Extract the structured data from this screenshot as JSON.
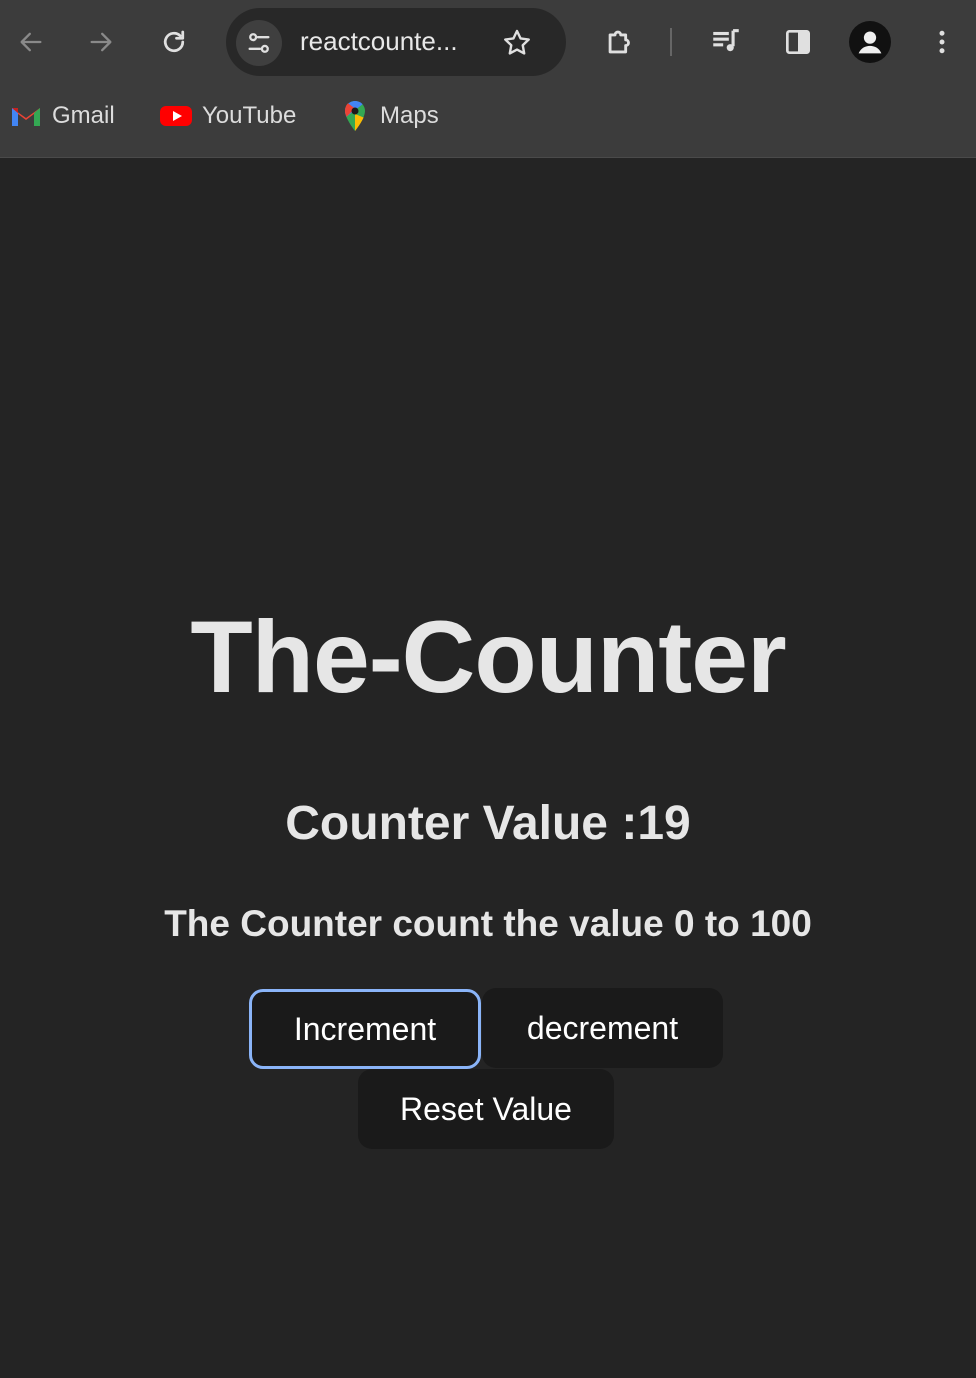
{
  "browser": {
    "url": "reactcounte...",
    "bookmarks": [
      {
        "label": "Gmail",
        "icon": "gmail-icon"
      },
      {
        "label": "YouTube",
        "icon": "youtube-icon"
      },
      {
        "label": "Maps",
        "icon": "maps-icon"
      }
    ]
  },
  "page": {
    "title": "The-Counter",
    "counter_value_text": "Counter Value :19",
    "range_text": "The Counter count the value 0 to 100",
    "buttons": {
      "increment": "Increment",
      "decrement": "decrement",
      "reset": "Reset Value"
    }
  },
  "colors": {
    "background": "#242424",
    "chrome": "#3c3c3c",
    "button_bg": "#1a1a1a",
    "focus_ring": "#8ab4f8",
    "text": "#e6e6e6"
  }
}
